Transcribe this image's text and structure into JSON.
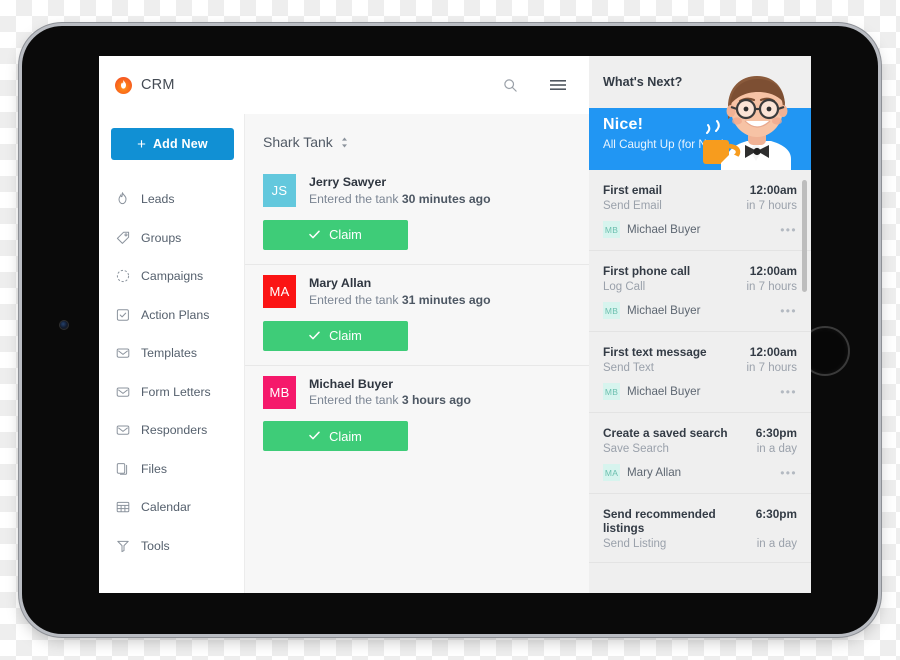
{
  "app": {
    "logo_text": "CRM",
    "logo_icon": "flame-icon",
    "search_icon": "search-icon",
    "menu_icon": "hamburger-menu-icon"
  },
  "sidebar": {
    "add_new_label": "Add New",
    "add_new_plus": "+",
    "items": [
      {
        "label": "Leads",
        "icon": "flame-icon"
      },
      {
        "label": "Groups",
        "icon": "tag-icon"
      },
      {
        "label": "Campaigns",
        "icon": "dashed-circle-icon"
      },
      {
        "label": "Action Plans",
        "icon": "checkbox-icon"
      },
      {
        "label": "Templates",
        "icon": "envelope-icon"
      },
      {
        "label": "Form Letters",
        "icon": "envelope-icon"
      },
      {
        "label": "Responders",
        "icon": "envelope-icon"
      },
      {
        "label": "Files",
        "icon": "copy-files-icon"
      },
      {
        "label": "Calendar",
        "icon": "calendar-grid-icon"
      },
      {
        "label": "Tools",
        "icon": "funnel-icon"
      }
    ]
  },
  "main": {
    "title": "Shark Tank",
    "sort_icon": "sort-updown-icon",
    "cards": [
      {
        "initials": "JS",
        "avatar_color": "#63c8dd",
        "name": "Jerry Sawyer",
        "sub_prefix": "Entered the tank ",
        "sub_strong": "30 minutes ago",
        "button_label": "Claim",
        "button_icon": "check-icon"
      },
      {
        "initials": "MA",
        "avatar_color": "#fb1414",
        "name": "Mary Allan",
        "sub_prefix": "Entered the tank ",
        "sub_strong": "31 minutes ago",
        "button_label": "Claim",
        "button_icon": "check-icon"
      },
      {
        "initials": "MB",
        "avatar_color": "#f5196b",
        "name": "Michael Buyer",
        "sub_prefix": "Entered the tank ",
        "sub_strong": "3 hours ago",
        "button_label": "Claim",
        "button_icon": "check-icon"
      }
    ]
  },
  "right_panel": {
    "header_title": "What's Next?",
    "hero_title": "Nice!",
    "hero_subtitle": "All Caught Up (for Now)",
    "hero_illustration": "man-with-coffee-mug-illustration",
    "tasks": [
      {
        "title": "First email",
        "time": "12:00am",
        "type": "Send Email",
        "relative": "in 7 hours",
        "person_initials": "MB",
        "person": "Michael Buyer",
        "more_icon": "ellipsis-icon"
      },
      {
        "title": "First phone call",
        "time": "12:00am",
        "type": "Log Call",
        "relative": "in 7 hours",
        "person_initials": "MB",
        "person": "Michael Buyer",
        "more_icon": "ellipsis-icon"
      },
      {
        "title": "First text message",
        "time": "12:00am",
        "type": "Send Text",
        "relative": "in 7 hours",
        "person_initials": "MB",
        "person": "Michael Buyer",
        "more_icon": "ellipsis-icon"
      },
      {
        "title": "Create a saved search",
        "time": "6:30pm",
        "type": "Save Search",
        "relative": "in a day",
        "person_initials": "MA",
        "person": "Mary Allan",
        "more_icon": "ellipsis-icon"
      },
      {
        "title": "Send recommended listings",
        "time": "6:30pm",
        "type": "Send Listing",
        "relative": "in a day",
        "person_initials": "",
        "person": "",
        "more_icon": "ellipsis-icon"
      }
    ]
  },
  "colors": {
    "accent_blue": "#1190d4",
    "hero_blue": "#2196f3",
    "claim_green": "#3ecc78",
    "panel_gray": "#efefef",
    "main_gray": "#f7f7f7"
  }
}
